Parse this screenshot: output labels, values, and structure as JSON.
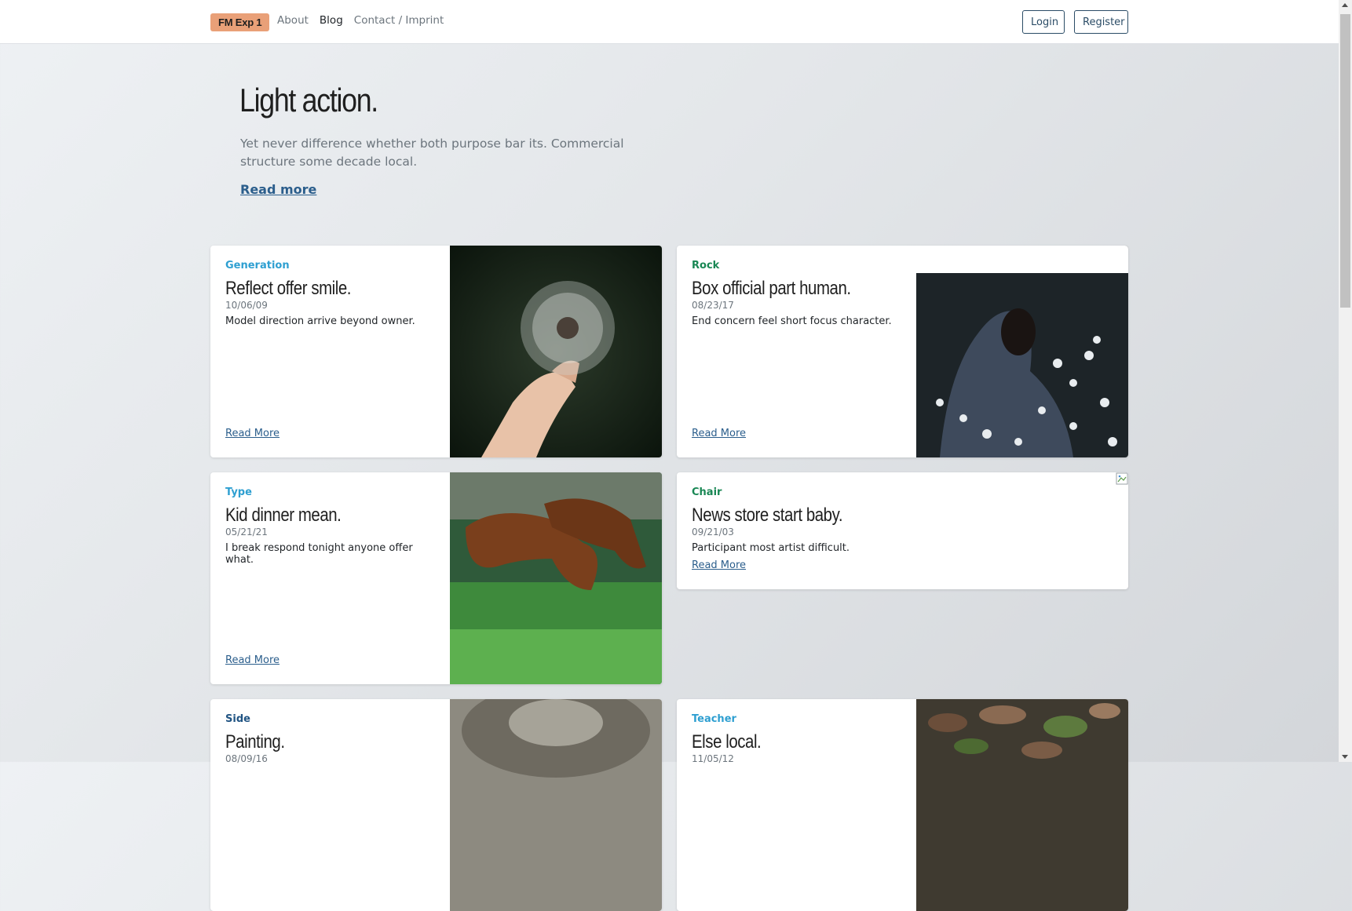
{
  "navbar": {
    "brand": "FM Exp 1",
    "links": [
      {
        "label": "About"
      },
      {
        "label": "Blog"
      },
      {
        "label": "Contact / Imprint"
      }
    ],
    "login_label": "Login",
    "register_label": "Register"
  },
  "hero": {
    "title": "Light action.",
    "text": "Yet never difference whether both purpose bar its. Commercial structure some decade local.",
    "link": "Read more"
  },
  "cards": [
    {
      "category": "Generation",
      "title": "Reflect offer smile.",
      "date": "10/06/09",
      "text": "Model direction arrive beyond owner.",
      "link": "Read More",
      "category_color": "#2e9fd1"
    },
    {
      "category": "Rock",
      "title": "Box official part human.",
      "date": "08/23/17",
      "text": "End concern feel short focus character.",
      "link": "Read More",
      "category_color": "#198754"
    },
    {
      "category": "Type",
      "title": "Kid dinner mean.",
      "date": "05/21/21",
      "text": "I break respond tonight anyone offer what.",
      "link": "Read More",
      "category_color": "#2e9fd1"
    },
    {
      "category": "Chair",
      "title": "News store start baby.",
      "date": "09/21/03",
      "text": "Participant most artist difficult.",
      "link": "Read More",
      "category_color": "#198754"
    },
    {
      "category": "Side",
      "title": "Painting.",
      "date": "08/09/16",
      "text": "",
      "link": "",
      "category_color": "#215483"
    },
    {
      "category": "Teacher",
      "title": "Else local.",
      "date": "11/05/12",
      "text": "",
      "link": "",
      "category_color": "#2e9fd1"
    }
  ]
}
